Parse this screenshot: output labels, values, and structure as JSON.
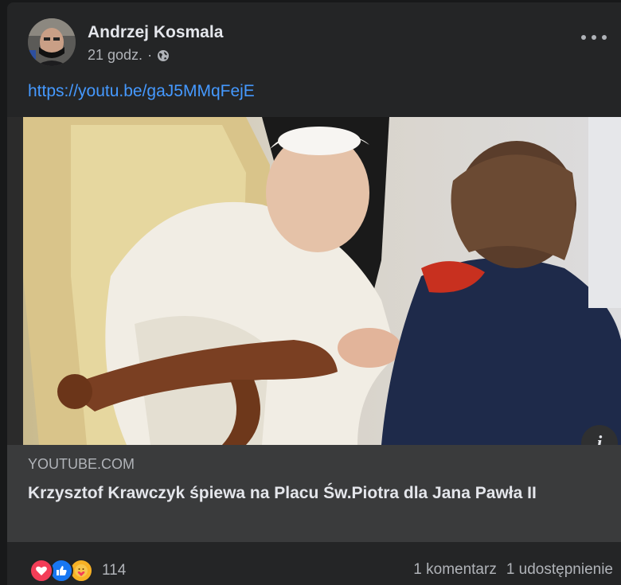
{
  "post": {
    "author": "Andrzej Kosmala",
    "time": "21 godz.",
    "separator": "·",
    "privacy_icon": "globe-icon",
    "more_icon": "more-horizontal-icon",
    "link_url": "https://youtu.be/gaJ5MMqFejE"
  },
  "link_preview": {
    "domain": "YOUTUBE.COM",
    "title": "Krzysztof Krawczyk śpiewa na Placu Św.Piotra dla Jana Pawła II",
    "info_icon": "info-icon"
  },
  "reactions": {
    "icons": [
      "love-icon",
      "like-icon",
      "care-icon"
    ],
    "count": "114"
  },
  "stats": {
    "comments": "1 komentarz",
    "shares": "1 udostępnienie"
  },
  "colors": {
    "background": "#18191a",
    "card": "#242526",
    "link": "#4599ff",
    "text": "#e4e6eb",
    "secondary_text": "#b0b3b8"
  }
}
